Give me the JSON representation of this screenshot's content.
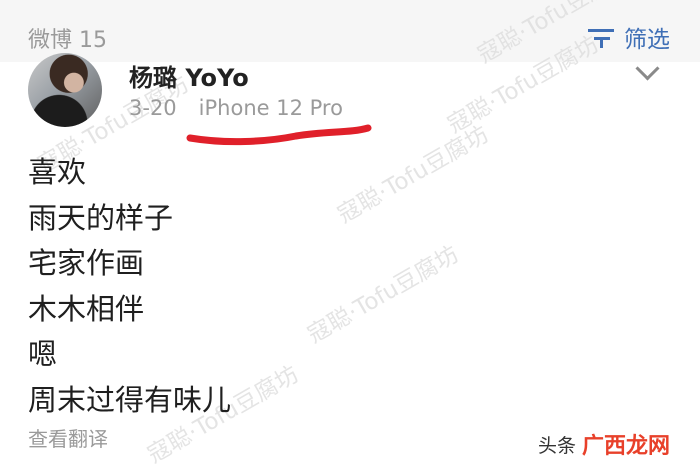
{
  "header": {
    "tab_title": "微博 15",
    "filter_label": "筛选",
    "filter_icon": "filter-icon"
  },
  "post": {
    "username": "杨璐 YoYo",
    "date": "3-20",
    "device": "iPhone 12 Pro",
    "lines": [
      "喜欢",
      "雨天的样子",
      "宅家作画",
      "木木相伴",
      "嗯",
      "周末过得有味儿"
    ],
    "translate_label": "查看翻译"
  },
  "watermark": {
    "text": "寇聪·Tofu豆腐坊"
  },
  "source": {
    "prefix": "头条",
    "logo": "广西龙网"
  },
  "colors": {
    "accent": "#3f6fb6",
    "annotation": "#e0202a",
    "muted": "#9a9a9a"
  }
}
